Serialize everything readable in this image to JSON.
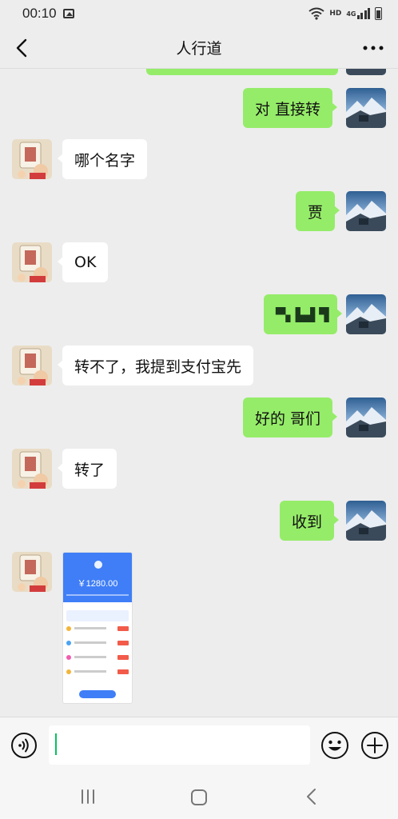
{
  "status_bar": {
    "time": "00:10",
    "net_label": "HD",
    "net_type": "4G"
  },
  "header": {
    "title": "人行道"
  },
  "messages": [
    {
      "dir": "out",
      "text": "对 直接转"
    },
    {
      "dir": "in",
      "text": "哪个名字"
    },
    {
      "dir": "out",
      "text": "贾"
    },
    {
      "dir": "in",
      "text": "OK"
    },
    {
      "dir": "out",
      "text": "▀▖▙▟ ▜"
    },
    {
      "dir": "in",
      "text": "转不了，我提到支付宝先"
    },
    {
      "dir": "out",
      "text": "好的 哥们"
    },
    {
      "dir": "in",
      "text": "转了"
    },
    {
      "dir": "out",
      "text": "收到"
    }
  ],
  "image_message": {
    "amount": "￥1280.00"
  },
  "colors": {
    "outgoing_bubble": "#95ec69",
    "incoming_bubble": "#ffffff",
    "background": "#ededed",
    "accent": "#07c160"
  }
}
